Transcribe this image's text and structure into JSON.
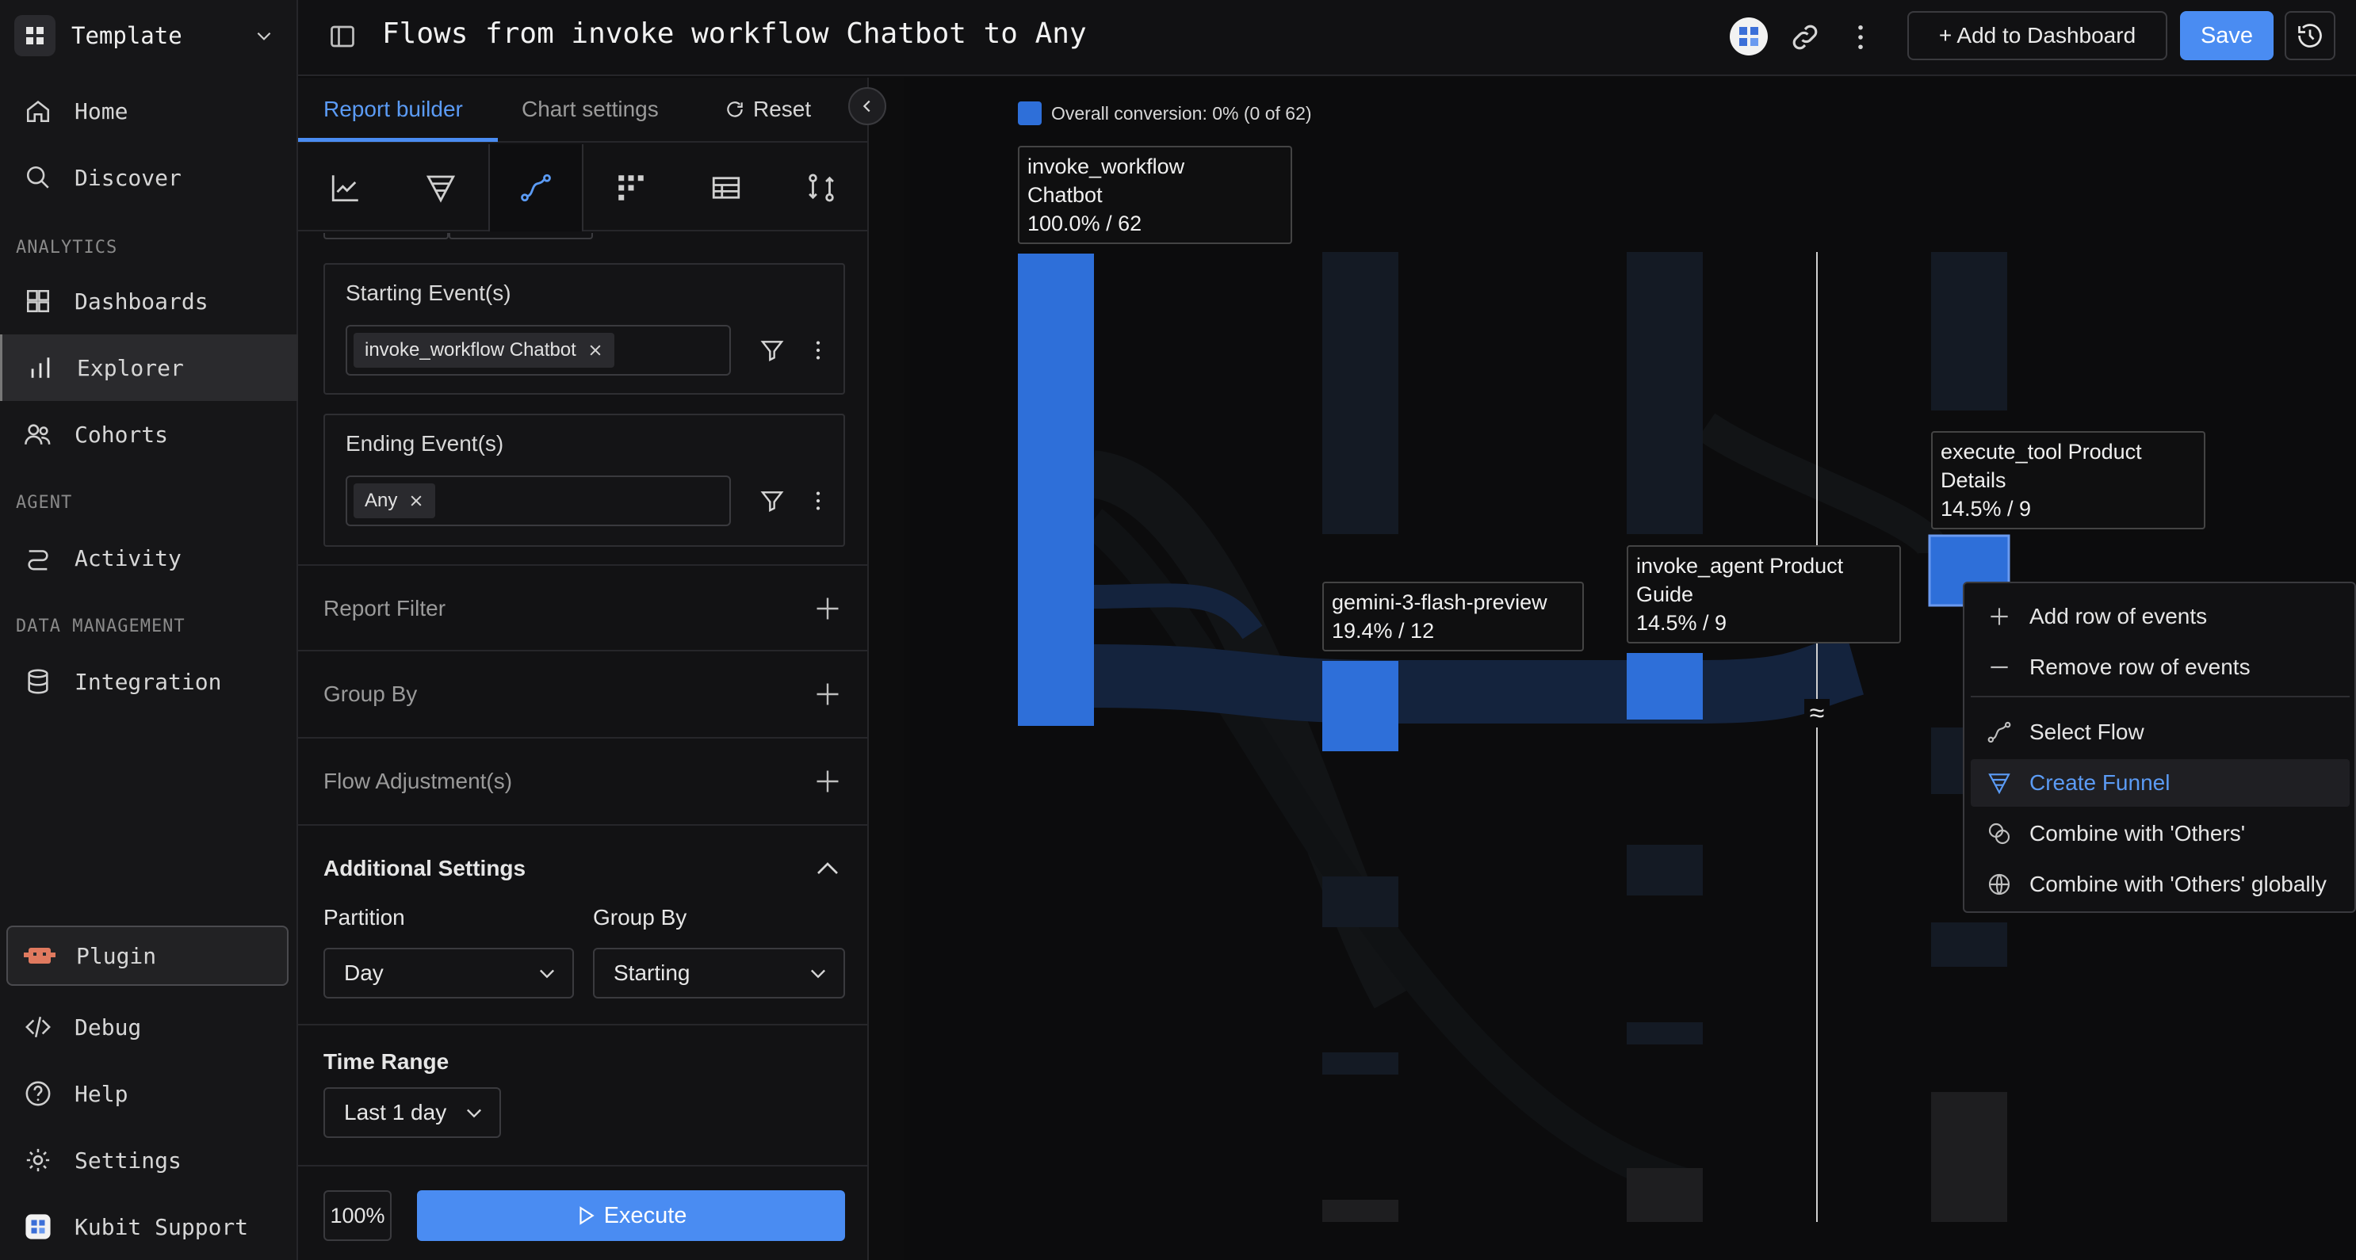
{
  "workspace": {
    "name": "Template"
  },
  "nav": {
    "home": "Home",
    "discover": "Discover",
    "analytics_section": "ANALYTICS",
    "dashboards": "Dashboards",
    "explorer": "Explorer",
    "cohorts": "Cohorts",
    "agent_section": "AGENT",
    "activity": "Activity",
    "data_section": "DATA MANAGEMENT",
    "integration": "Integration",
    "plugin": "Plugin",
    "debug": "Debug",
    "help": "Help",
    "settings": "Settings",
    "support": "Kubit Support"
  },
  "header": {
    "title": "Flows from invoke workflow Chatbot to Any",
    "add_dashboard": "+ Add to Dashboard",
    "save": "Save"
  },
  "panel": {
    "tabs": {
      "report_builder": "Report builder",
      "chart_settings": "Chart settings",
      "reset": "Reset"
    },
    "starting": {
      "title": "Starting Event(s)",
      "chip": "invoke_workflow Chatbot"
    },
    "ending": {
      "title": "Ending Event(s)",
      "chip": "Any"
    },
    "report_filter": "Report Filter",
    "group_by": "Group By",
    "flow_adjustments": "Flow Adjustment(s)",
    "additional_settings": "Additional Settings",
    "partition_label": "Partition",
    "partition_value": "Day",
    "groupby_label": "Group By",
    "groupby_value": "Starting",
    "time_range_label": "Time Range",
    "time_range_value": "Last 1 day",
    "zoom": "100%",
    "execute": "Execute"
  },
  "chart": {
    "legend": "Overall conversion: 0% (0 of 62)",
    "nodes": [
      {
        "name": "invoke_workflow",
        "name2": "Chatbot",
        "stat": "100.0% / 62"
      },
      {
        "name": "gemini-3-flash-preview",
        "name2": "",
        "stat": "19.4% / 12"
      },
      {
        "name": "invoke_agent Product",
        "name2": "Guide",
        "stat": "14.5% / 9"
      },
      {
        "name": "execute_tool Product",
        "name2": "Details",
        "stat": "14.5% / 9"
      }
    ],
    "break_marker": "≈"
  },
  "chart_data": {
    "type": "sankey",
    "title": "Flows from invoke workflow Chatbot to Any",
    "steps": [
      {
        "step": 1,
        "event": "invoke_workflow Chatbot",
        "percent": 100.0,
        "count": 62
      },
      {
        "step": 2,
        "event": "gemini-3-flash-preview",
        "percent": 19.4,
        "count": 12
      },
      {
        "step": 3,
        "event": "invoke_agent Product Guide",
        "percent": 14.5,
        "count": 9
      },
      {
        "step": 4,
        "event": "execute_tool Product Details",
        "percent": 14.5,
        "count": 9
      }
    ],
    "overall_conversion": {
      "percent": 0,
      "converted": 0,
      "total": 62
    }
  },
  "context_menu": {
    "add_row": "Add row of events",
    "remove_row": "Remove row of events",
    "select_flow": "Select Flow",
    "create_funnel": "Create Funnel",
    "combine_others": "Combine with 'Others'",
    "combine_global": "Combine with 'Others' globally"
  },
  "colors": {
    "accent": "#4a8cf2",
    "node": "#2e6fd9",
    "link": "#14233d",
    "bg": "#0c0c0d"
  }
}
